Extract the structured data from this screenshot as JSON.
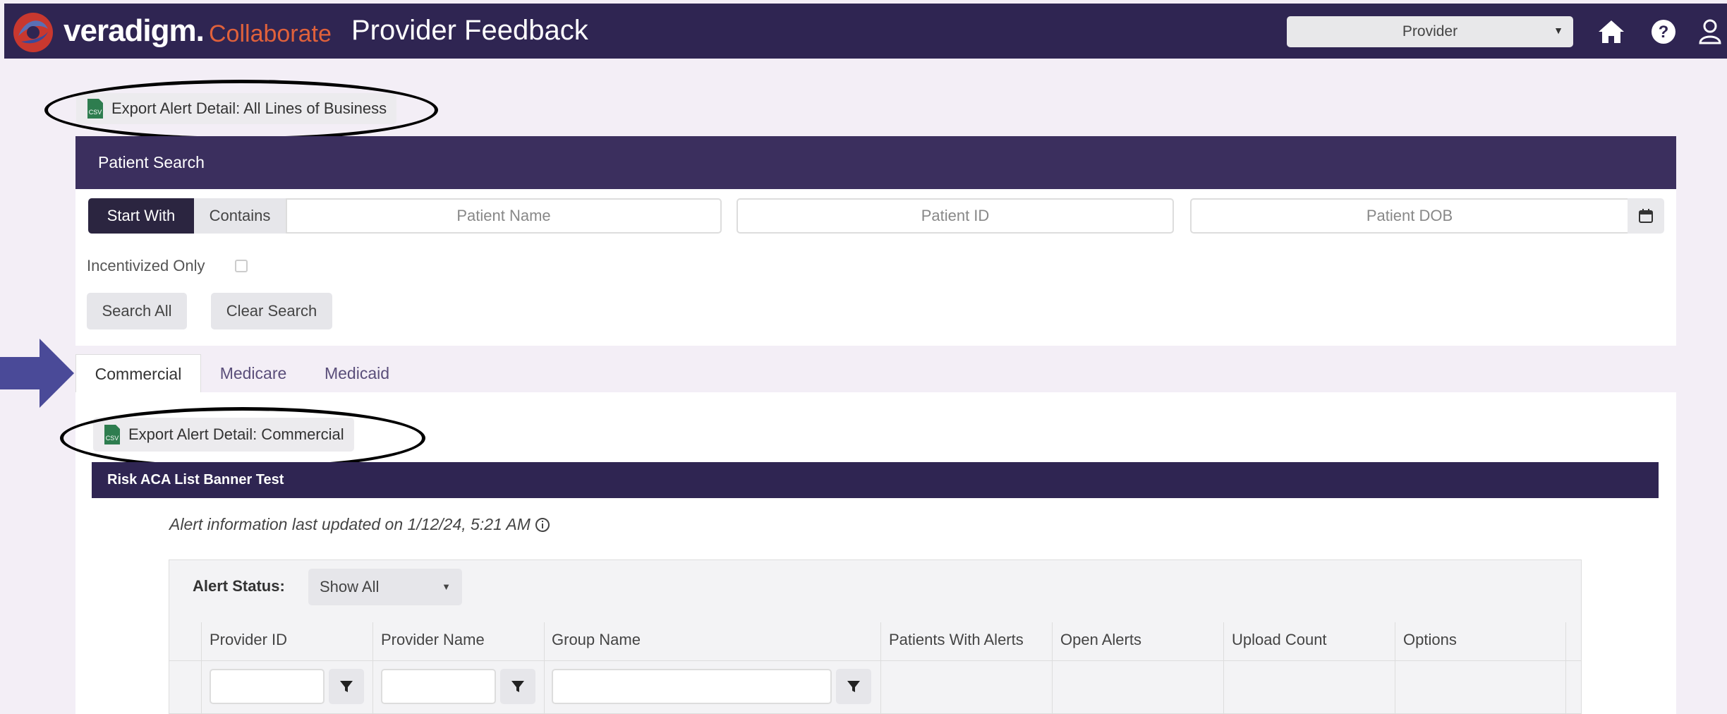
{
  "header": {
    "brand": "veradigm.",
    "brand_sub": "Collaborate",
    "app_title": "Provider Feedback",
    "role_select": "Provider",
    "icons": [
      "home-icon",
      "help-icon",
      "user-icon"
    ],
    "colors": {
      "bar": "#2f2552",
      "accent": "#e0613b"
    }
  },
  "export_all": {
    "label": "Export Alert Detail: All Lines of Business",
    "icon": "csv-file-icon"
  },
  "patient_search": {
    "title": "Patient Search",
    "mode_options": [
      "Start With",
      "Contains"
    ],
    "active_mode": "Start With",
    "name_placeholder": "Patient Name",
    "id_placeholder": "Patient ID",
    "dob_placeholder": "Patient DOB",
    "incentivized_label": "Incentivized Only",
    "search_all": "Search All",
    "clear_search": "Clear Search"
  },
  "tabs": [
    "Commercial",
    "Medicare",
    "Medicaid"
  ],
  "active_tab": "Commercial",
  "export_lob": {
    "label": "Export Alert Detail: Commercial",
    "icon": "csv-file-icon"
  },
  "banner": "Risk ACA List Banner Test",
  "updated_text": "Alert information last updated on 1/12/24, 5:21 AM",
  "alert_status": {
    "label": "Alert Status:",
    "value": "Show All"
  },
  "table": {
    "columns": [
      "Provider ID",
      "Provider Name",
      "Group Name",
      "Patients With Alerts",
      "Open Alerts",
      "Upload Count",
      "Options"
    ]
  }
}
